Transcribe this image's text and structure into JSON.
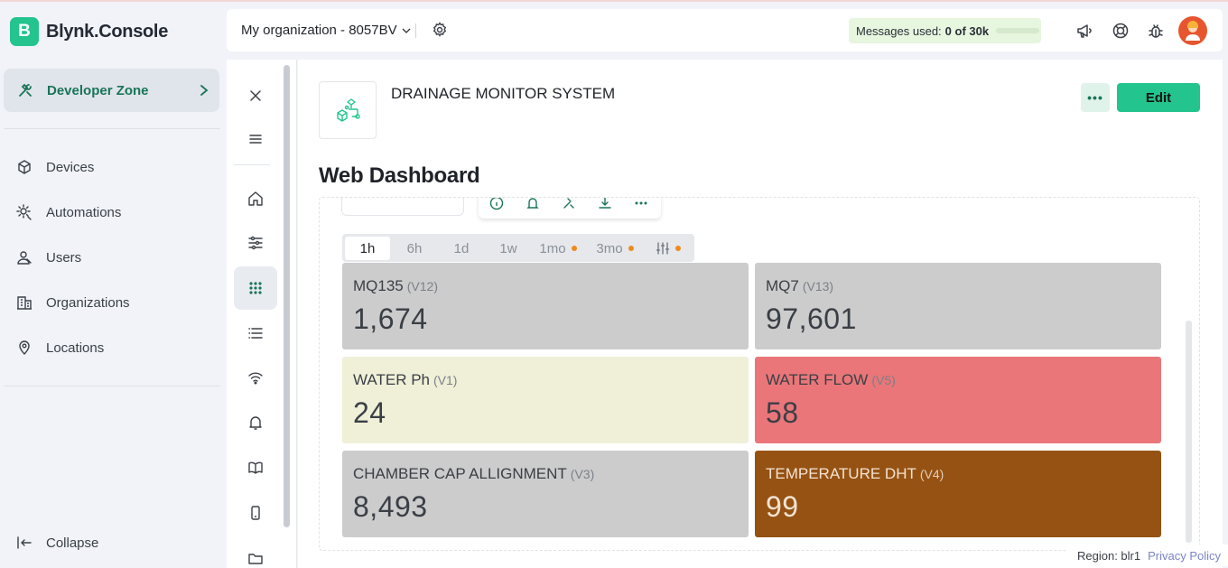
{
  "app": {
    "logo_letter": "B",
    "name": "Blynk.Console"
  },
  "sidebar": {
    "developer_zone": "Developer Zone",
    "items": [
      {
        "label": "Devices",
        "icon": "cube-icon"
      },
      {
        "label": "Automations",
        "icon": "automation-icon"
      },
      {
        "label": "Users",
        "icon": "users-icon"
      },
      {
        "label": "Organizations",
        "icon": "building-icon"
      },
      {
        "label": "Locations",
        "icon": "location-pin-icon"
      }
    ],
    "collapse": "Collapse"
  },
  "header": {
    "org": "My organization - 8057BV",
    "messages_label": "Messages used:",
    "messages_value": "0 of 30k"
  },
  "template": {
    "title": "DRAINAGE MONITOR SYSTEM",
    "more": "•••",
    "edit": "Edit",
    "dashboard_title": "Web Dashboard"
  },
  "time_tabs": [
    "1h",
    "6h",
    "1d",
    "1w",
    "1mo",
    "3mo"
  ],
  "widgets": [
    {
      "name": "MQ135",
      "pin": "(V12)",
      "value": "1,674",
      "color": "#cccccc"
    },
    {
      "name": "MQ7",
      "pin": "(V13)",
      "value": "97,601",
      "color": "#cccccc"
    },
    {
      "name": "WATER Ph",
      "pin": "(V1)",
      "value": "24",
      "color": "#f0f0d8"
    },
    {
      "name": "WATER FLOW",
      "pin": "(V5)",
      "value": "58",
      "color": "#ea7679"
    },
    {
      "name": "CHAMBER CAP ALLIGNMENT",
      "pin": "(V3)",
      "value": "8,493",
      "color": "#cccccc"
    },
    {
      "name": "TEMPERATURE DHT",
      "pin": "(V4)",
      "value": "99",
      "color": "#955213"
    }
  ],
  "footer": {
    "region": "Region: blr1",
    "privacy": "Privacy Policy"
  }
}
